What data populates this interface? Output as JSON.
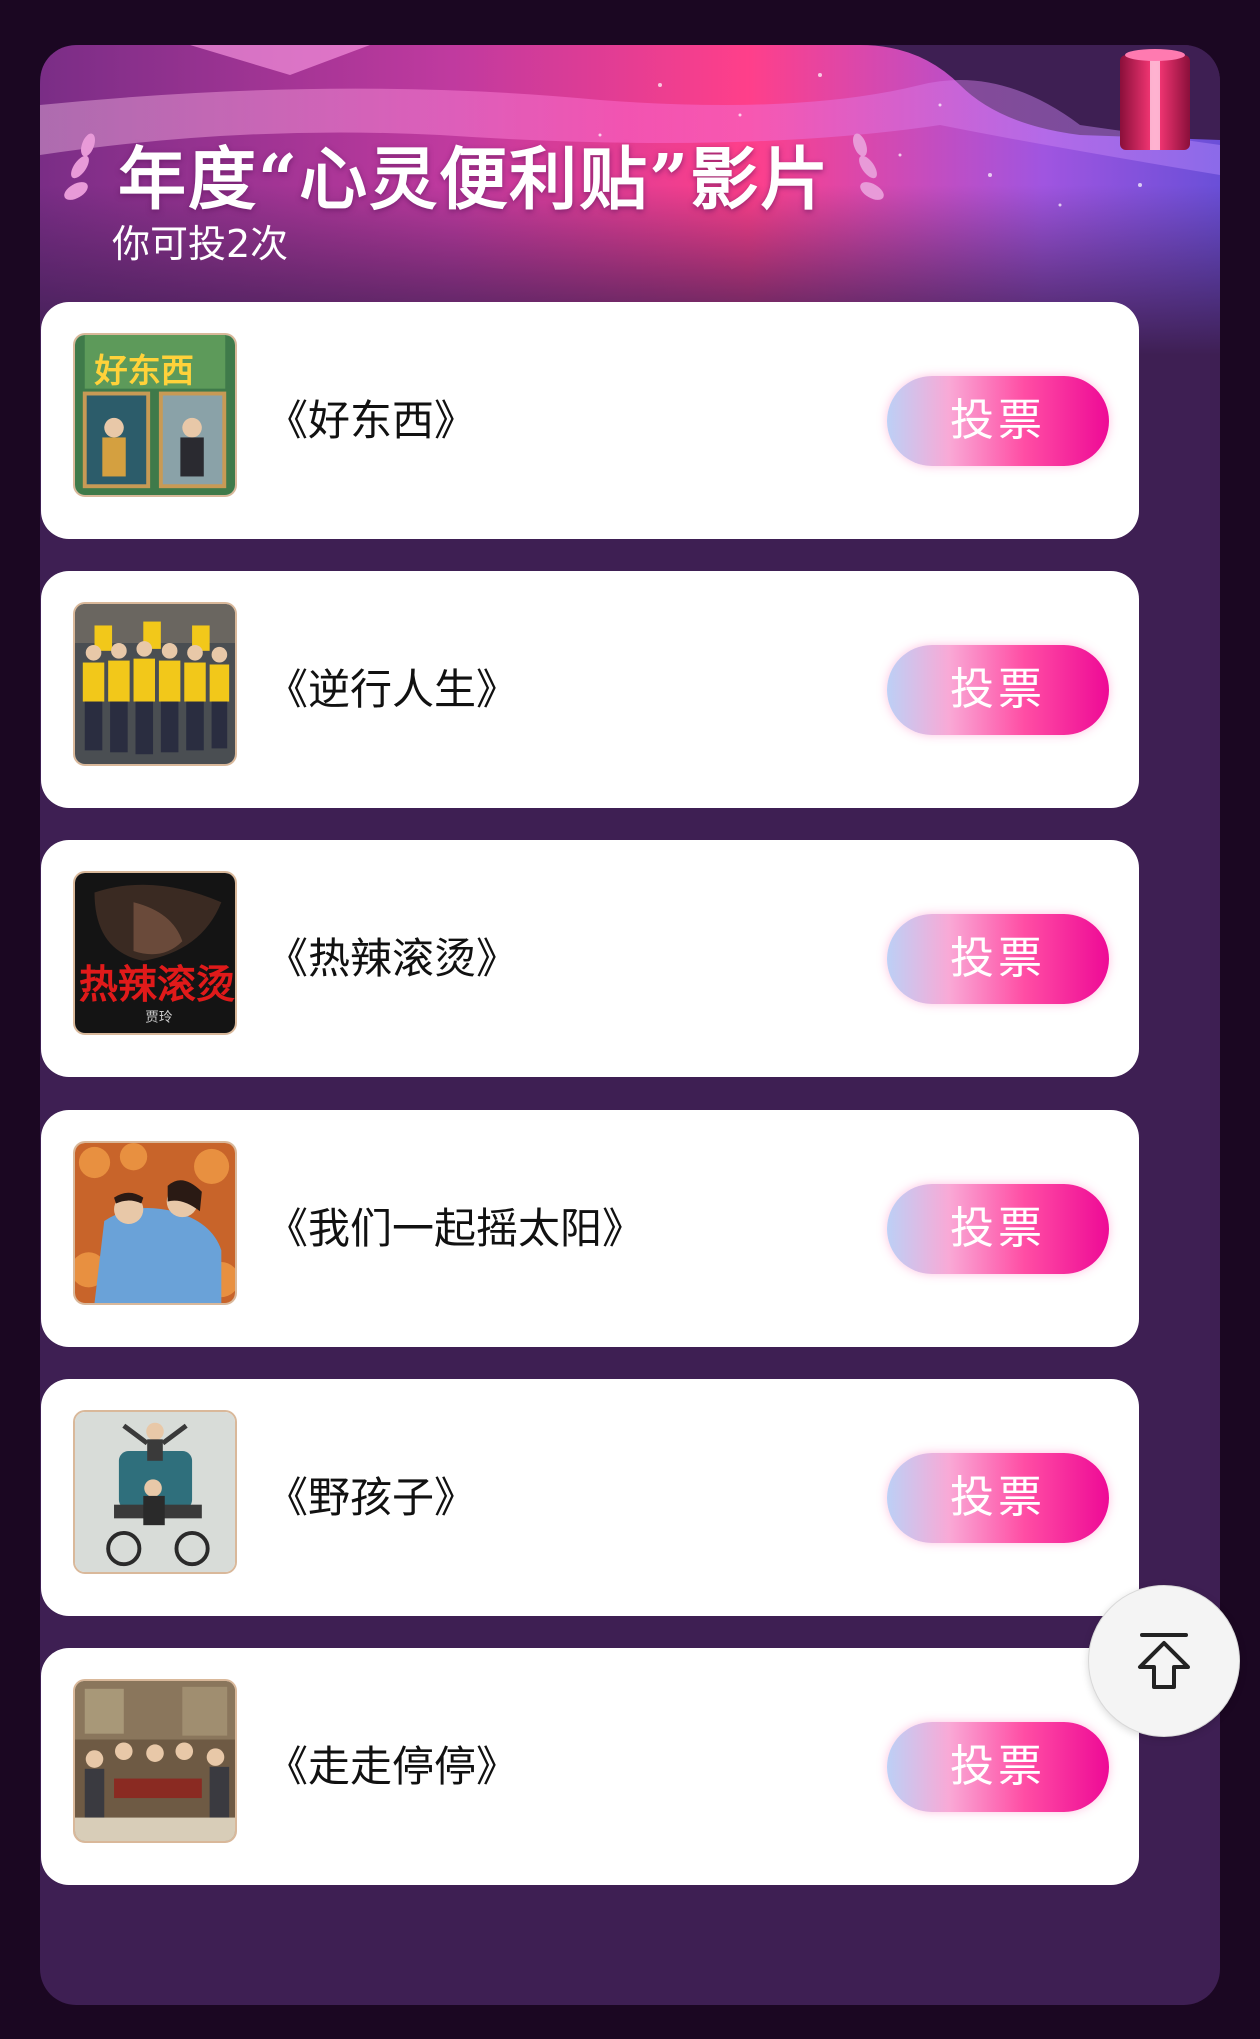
{
  "header": {
    "title": "年度“心灵便利贴”影片",
    "subtitle": "你可投2次"
  },
  "movies": [
    {
      "title": "《好东西》",
      "vote_label": "投票",
      "poster_icon": "poster-hao-dong-xi"
    },
    {
      "title": "《逆行人生》",
      "vote_label": "投票",
      "poster_icon": "poster-ni-xing-ren-sheng"
    },
    {
      "title": "《热辣滚烫》",
      "vote_label": "投票",
      "poster_icon": "poster-re-la-gun-tang"
    },
    {
      "title": "《我们一起摇太阳》",
      "vote_label": "投票",
      "poster_icon": "poster-wo-men-yi-qi-yao-tai-yang"
    },
    {
      "title": "《野孩子》",
      "vote_label": "投票",
      "poster_icon": "poster-ye-hai-zi"
    },
    {
      "title": "《走走停停》",
      "vote_label": "投票",
      "poster_icon": "poster-zou-zou-ting-ting"
    }
  ],
  "scroll_top_icon": "arrow-up-icon",
  "colors": {
    "page_bg": "#1b0722",
    "panel_bg": "#3e1f53",
    "card_bg": "#ffffff",
    "vote_gradient_start": "#bcd0f6",
    "vote_gradient_end": "#ee0a96"
  }
}
